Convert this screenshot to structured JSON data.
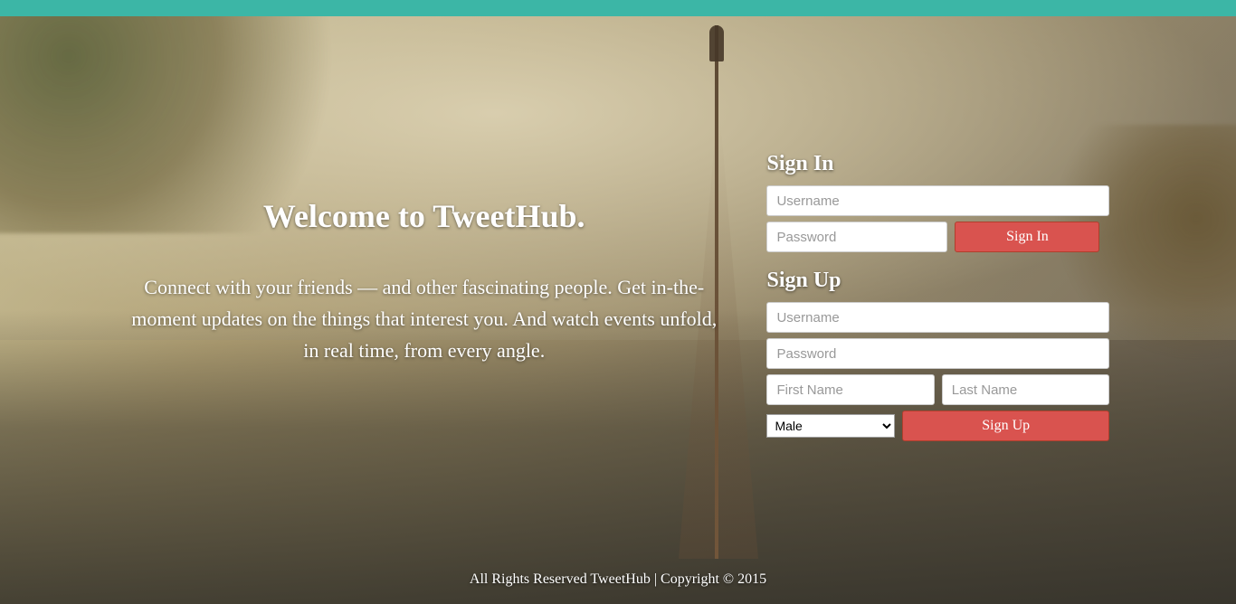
{
  "hero": {
    "title": "Welcome to TweetHub.",
    "blurb": "Connect with your friends — and other fascinating people. Get in-the-moment updates on the things that interest you. And watch events unfold, in real time, from every angle."
  },
  "signin": {
    "heading": "Sign In",
    "username_placeholder": "Username",
    "password_placeholder": "Password",
    "button_label": "Sign In"
  },
  "signup": {
    "heading": "Sign Up",
    "username_placeholder": "Username",
    "password_placeholder": "Password",
    "firstname_placeholder": "First Name",
    "lastname_placeholder": "Last Name",
    "gender_selected": "Male",
    "button_label": "Sign Up"
  },
  "footer": {
    "text": "All Rights Reserved TweetHub | Copyright © 2015"
  },
  "colors": {
    "accent": "#3cb6a6",
    "danger": "#d9534f"
  }
}
